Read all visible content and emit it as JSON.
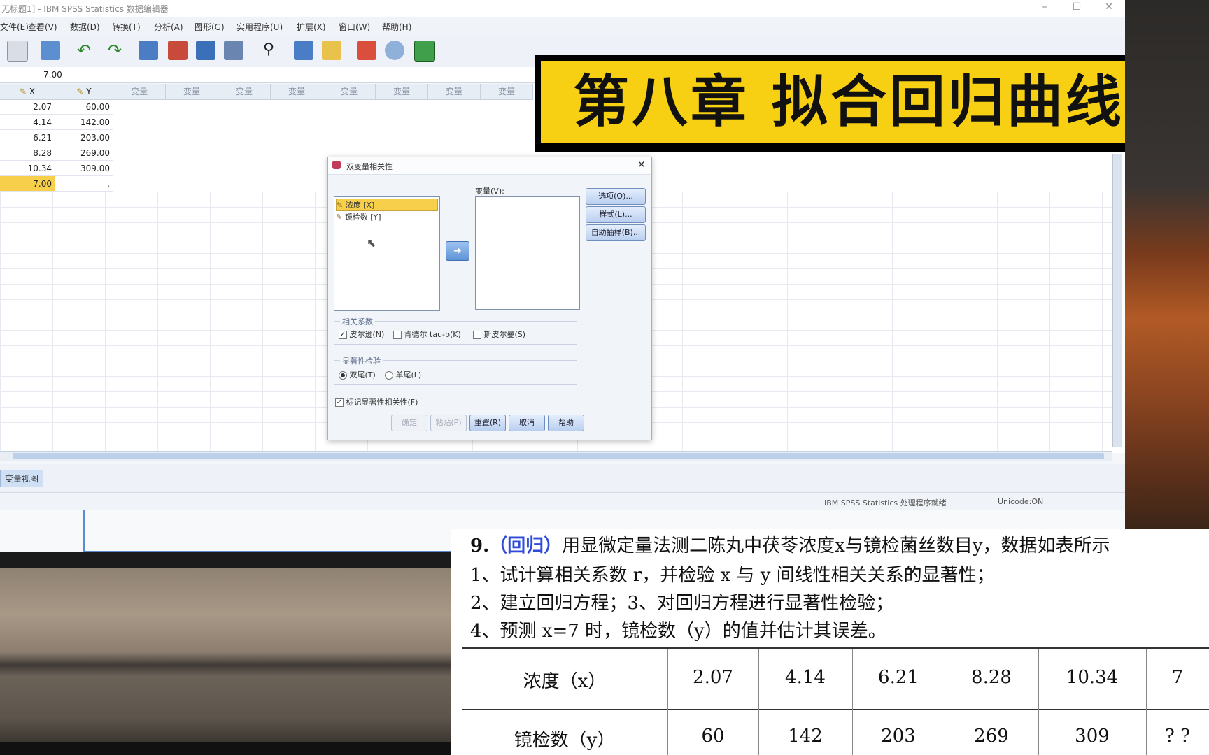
{
  "window": {
    "title": "无标题1] - IBM SPSS Statistics 数据编辑器",
    "min": "–",
    "max": "☐",
    "close": "✕"
  },
  "menu": [
    "文件(E)",
    "查看(V)",
    "数据(D)",
    "转换(T)",
    "分析(A)",
    "图形(G)",
    "实用程序(U)",
    "扩展(X)",
    "窗口(W)",
    "帮助(H)"
  ],
  "cell_value": "7.00",
  "grid": {
    "headers": [
      "X",
      "Y",
      "变量",
      "变量",
      "变量",
      "变量",
      "变量",
      "变量",
      "变量",
      "变量"
    ],
    "rows": [
      [
        "2.07",
        "60.00"
      ],
      [
        "4.14",
        "142.00"
      ],
      [
        "6.21",
        "203.00"
      ],
      [
        "8.28",
        "269.00"
      ],
      [
        "10.34",
        "309.00"
      ],
      [
        "7.00",
        "."
      ]
    ]
  },
  "tabs": {
    "active": "变量视图"
  },
  "status": {
    "processor": "IBM SPSS Statistics 处理程序就绪",
    "unicode": "Unicode:ON"
  },
  "dialog": {
    "title": "双变量相关性",
    "source_items": [
      "浓度 [X]",
      "镜检数 [Y]"
    ],
    "target_label": "变量(V):",
    "side_buttons": [
      "选项(O)...",
      "样式(L)...",
      "自助抽样(B)..."
    ],
    "coef_group": "相关系数",
    "coef_options": [
      "皮尔逊(N)",
      "肯德尔 tau-b(K)",
      "斯皮尔曼(S)"
    ],
    "sig_group": "显著性检验",
    "sig_options": [
      "双尾(T)",
      "单尾(L)"
    ],
    "flag_label": "标记显著性相关性(F)",
    "buttons": [
      "确定",
      "粘贴(P)",
      "重置(R)",
      "取消",
      "帮助"
    ]
  },
  "banner": {
    "text": "第八章  拟合回归曲线",
    "bg": "#f7cf13"
  },
  "problem": {
    "num": "9.",
    "tag": "（回归）",
    "line1": "用显微定量法测二陈丸中茯苓浓度x与镜检菌丝数目y，数据如表所示",
    "line2": "1、试计算相关系数 r，并检验 x 与 y 间线性相关关系的显著性；",
    "line3": "2、建立回归方程；3、对回归方程进行显著性检验；",
    "line4": "4、预测  x=7 时，镜检数（y）的值并估计其误差。",
    "table": {
      "row1_label": "浓度（x）",
      "row1": [
        "2.07",
        "4.14",
        "6.21",
        "8.28",
        "10.34",
        "7"
      ],
      "row2_label": "镜检数（y）",
      "row2": [
        "60",
        "142",
        "203",
        "269",
        "309",
        "? ?"
      ]
    }
  }
}
